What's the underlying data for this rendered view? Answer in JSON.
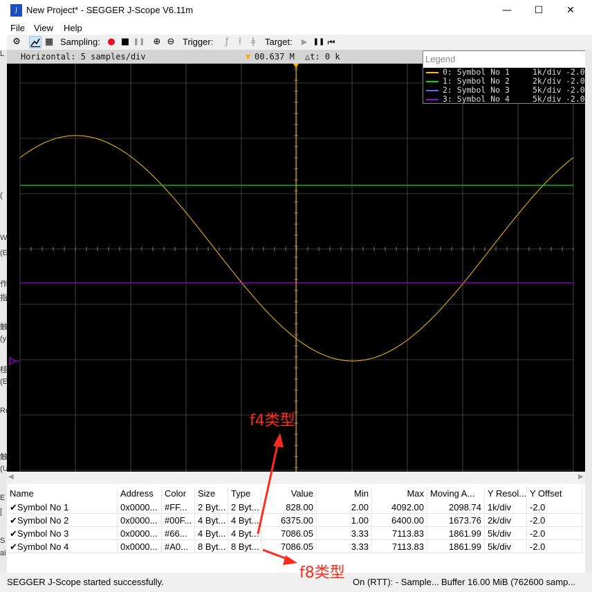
{
  "window": {
    "title": "New Project* - SEGGER J-Scope V6.11m",
    "app_icon_label": "J",
    "controls": {
      "minimize": "—",
      "maximize": "☐",
      "close": "✕"
    }
  },
  "menu": [
    "File",
    "View",
    "Help"
  ],
  "toolbar": {
    "sampling_label": "Sampling:",
    "trigger_label": "Trigger:",
    "target_label": "Target:",
    "icons": {
      "settings": "⚙",
      "graph": "📈",
      "table": "▦",
      "record": "●",
      "stop": "■",
      "pause": "❚❚",
      "zoom_in": "⊕",
      "zoom_out": "⊖",
      "trig_rise": "ƒ",
      "trig_fall": "ł",
      "trig_both": "ǂ",
      "play": "▶",
      "target_pause": "❚❚",
      "skip_start": "⏮"
    },
    "colors": {
      "record": "#e81123"
    }
  },
  "scope": {
    "horizontal": "Horizontal: 5 samples/div",
    "cursor_value": "00.637 M",
    "delta_t": "△t: 0 k",
    "background": "#000000",
    "grid_color": "#6e6e6e",
    "marker_color": "#ffa500",
    "legend": {
      "title": "Legend",
      "entries": [
        {
          "index_name": "0: Symbol No 1",
          "resolution": "1k/div",
          "offset": "-2.0",
          "color": "#ffc000"
        },
        {
          "index_name": "1: Symbol No 2",
          "resolution": "2k/div",
          "offset": "-2.0",
          "color": "#00e000"
        },
        {
          "index_name": "2: Symbol No 3",
          "resolution": "5k/div",
          "offset": "-2.0",
          "color": "#6666ff"
        },
        {
          "index_name": "3: Symbol No 4",
          "resolution": "5k/div",
          "offset": "-2.0",
          "color": "#a000e0"
        }
      ]
    }
  },
  "scrollbar": {
    "left_arrow": "◀",
    "right_arrow": "▶"
  },
  "table": {
    "columns": [
      "Name",
      "Address",
      "Color",
      "Size",
      "Type",
      "Value",
      "Min",
      "Max",
      "Moving A...",
      "Y Resol...",
      "Y Offset"
    ],
    "check_glyph": "✔",
    "rows": [
      [
        "Symbol No 1",
        "0x0000...",
        "#FF...",
        "2 Byt...",
        "2 Byt...",
        "828.00",
        "2.00",
        "4092.00",
        "2098.74",
        "1k/div",
        "-2.0"
      ],
      [
        "Symbol No 2",
        "0x0000...",
        "#00F...",
        "4 Byt...",
        "4 Byt...",
        "6375.00",
        "1.00",
        "6400.00",
        "1673.76",
        "2k/div",
        "-2.0"
      ],
      [
        "Symbol No 3",
        "0x0000...",
        "#66...",
        "4 Byt...",
        "4 Byt...",
        "7086.05",
        "3.33",
        "7113.83",
        "1861.99",
        "5k/div",
        "-2.0"
      ],
      [
        "Symbol No 4",
        "0x0000...",
        "#A0...",
        "8 Byt...",
        "8 Byt...",
        "7086.05",
        "3.33",
        "7113.83",
        "1861.99",
        "5k/div",
        "-2.0"
      ]
    ]
  },
  "annotations": {
    "f4": "f4类型",
    "f8": "f8类型",
    "color": "#ff2a1a"
  },
  "status": {
    "message": "SEGGER J-Scope started successfully.",
    "connection": "On (RTT): - Sample...",
    "buffer": "Buffer 16.00 MiB (762600 samp..."
  },
  "left_fragments": [
    "L",
    "(",
    "W",
    "(E",
    "作",
    "指",
    "触",
    "(y",
    "桂",
    "(E",
    "Ro",
    "触",
    "(U",
    "E",
    "[",
    "S",
    "ai"
  ]
}
